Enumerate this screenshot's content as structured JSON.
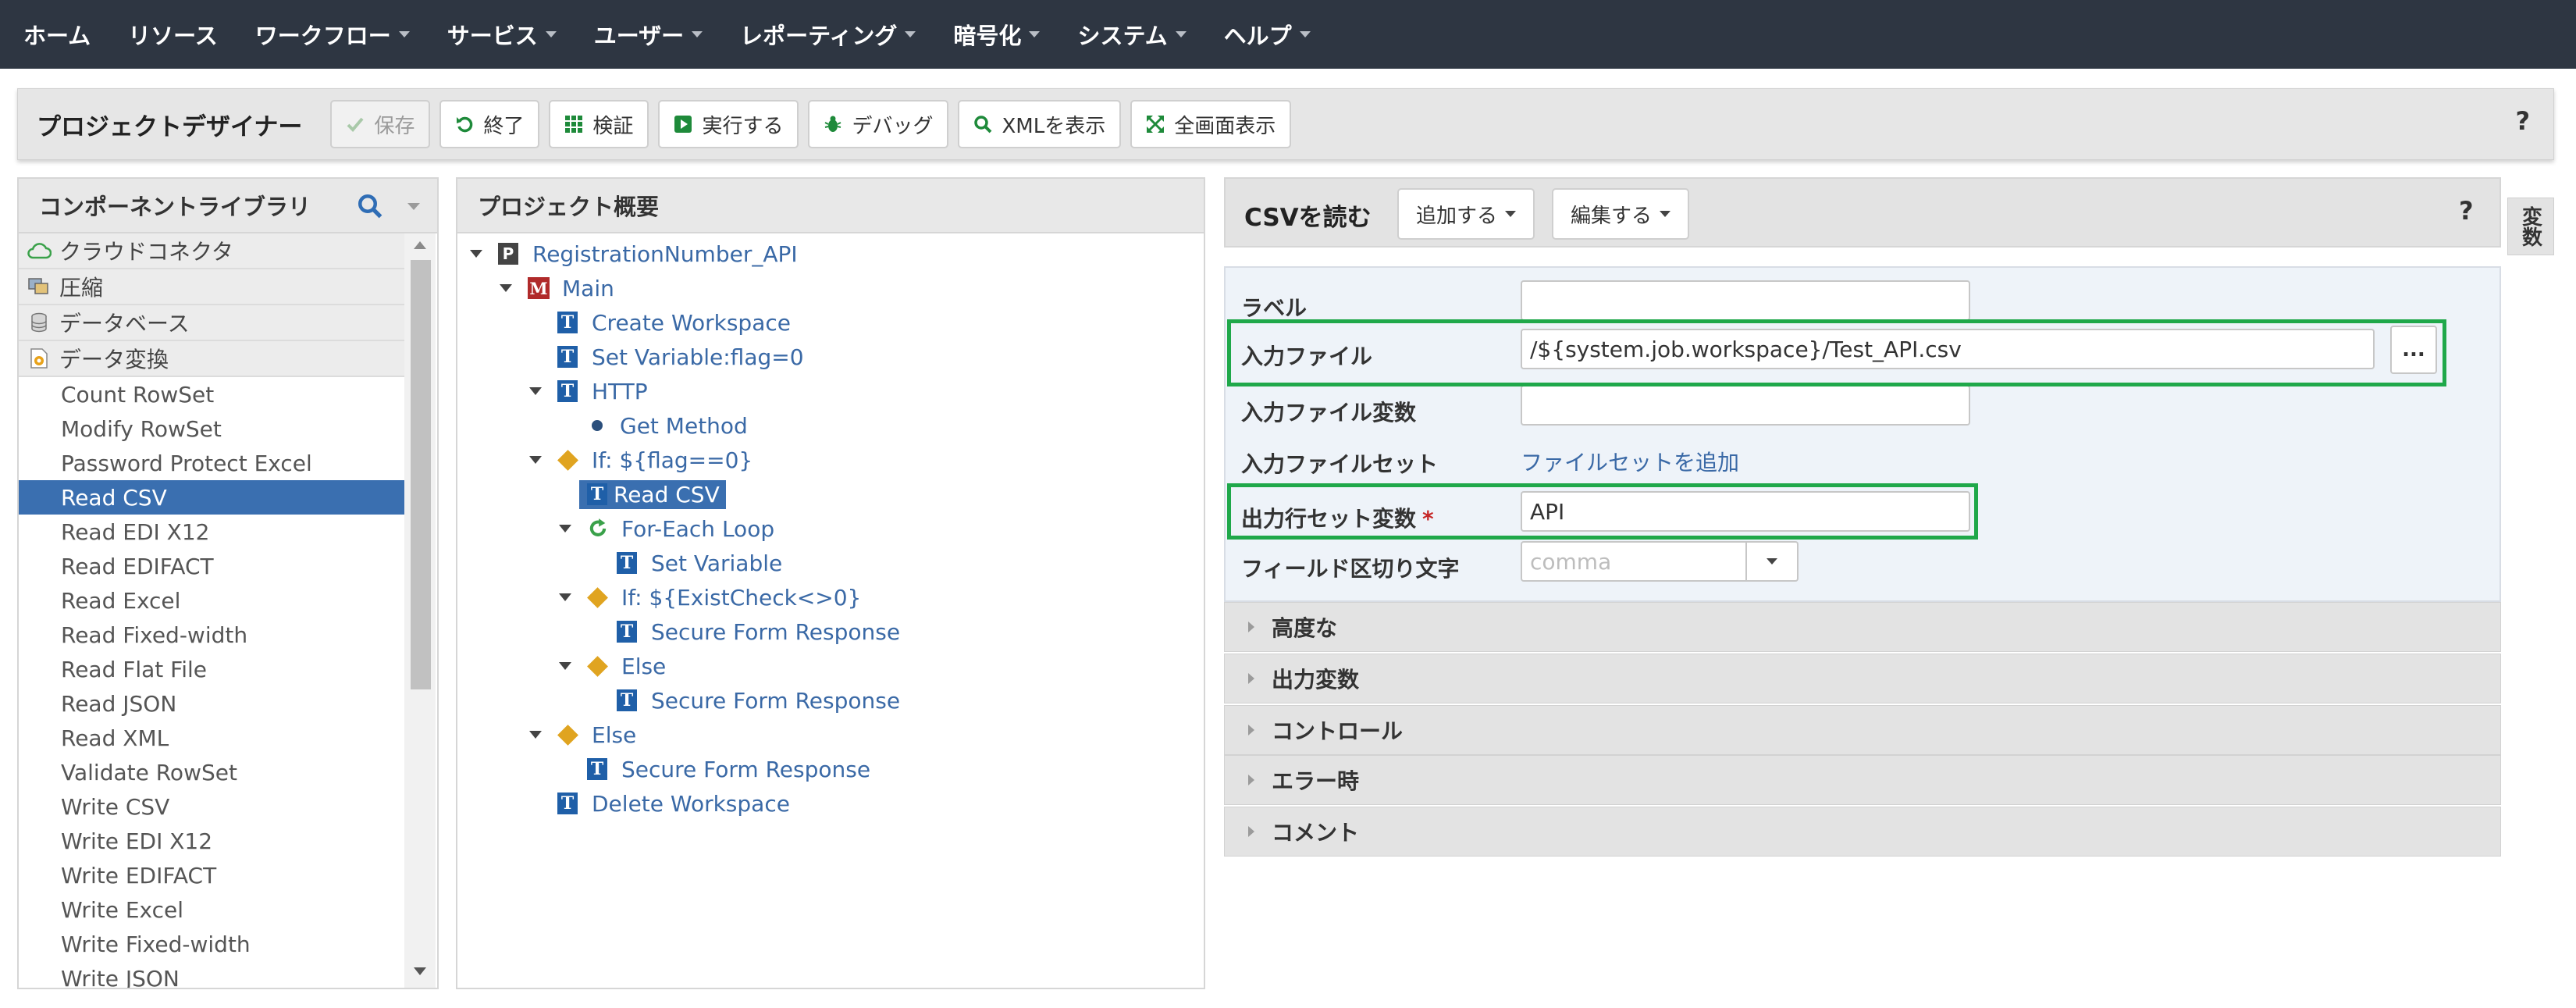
{
  "nav": {
    "items": [
      {
        "label": "ホーム",
        "has_caret": false
      },
      {
        "label": "リソース",
        "has_caret": false
      },
      {
        "label": "ワークフロー",
        "has_caret": true
      },
      {
        "label": "サービス",
        "has_caret": true
      },
      {
        "label": "ユーザー",
        "has_caret": true
      },
      {
        "label": "レポーティング",
        "has_caret": true
      },
      {
        "label": "暗号化",
        "has_caret": true
      },
      {
        "label": "システム",
        "has_caret": true
      },
      {
        "label": "ヘルプ",
        "has_caret": true
      }
    ]
  },
  "toolbar": {
    "title": "プロジェクトデザイナー",
    "buttons": [
      {
        "label": "保存",
        "icon": "check-icon",
        "disabled": true
      },
      {
        "label": "終了",
        "icon": "undo-icon",
        "disabled": false
      },
      {
        "label": "検証",
        "icon": "grid-icon",
        "disabled": false
      },
      {
        "label": "実行する",
        "icon": "play-icon",
        "disabled": false
      },
      {
        "label": "デバッグ",
        "icon": "bug-icon",
        "disabled": false
      },
      {
        "label": "XMLを表示",
        "icon": "search-icon",
        "disabled": false
      },
      {
        "label": "全画面表示",
        "icon": "expand-icon",
        "disabled": false
      }
    ],
    "help": "?"
  },
  "library": {
    "title": "コンポーネントライブラリ",
    "categories": [
      {
        "label": "クラウドコネクタ",
        "icon": "cloud-icon"
      },
      {
        "label": "圧縮",
        "icon": "compress-icon"
      },
      {
        "label": "データベース",
        "icon": "database-icon"
      },
      {
        "label": "データ変換",
        "icon": "transform-icon"
      }
    ],
    "items": [
      "Count RowSet",
      "Modify RowSet",
      "Password Protect Excel",
      "Read CSV",
      "Read EDI X12",
      "Read EDIFACT",
      "Read Excel",
      "Read Fixed-width",
      "Read Flat File",
      "Read JSON",
      "Read XML",
      "Validate RowSet",
      "Write CSV",
      "Write EDI X12",
      "Write EDIFACT",
      "Write Excel",
      "Write Fixed-width",
      "Write JSON"
    ],
    "selected_item": "Read CSV"
  },
  "overview": {
    "title": "プロジェクト概要",
    "nodes": [
      {
        "label": "RegistrationNumber_API",
        "icon": "project-icon",
        "depth": 0,
        "expanded": true
      },
      {
        "label": "Main",
        "icon": "module-icon",
        "depth": 1,
        "expanded": true
      },
      {
        "label": "Create Workspace",
        "icon": "task-icon",
        "depth": 2
      },
      {
        "label": "Set Variable:flag=0",
        "icon": "task-icon",
        "depth": 2
      },
      {
        "label": "HTTP",
        "icon": "task-icon",
        "depth": 2,
        "expanded": true
      },
      {
        "label": "Get Method",
        "icon": "bullet-icon",
        "depth": 3
      },
      {
        "label": "If: ${flag==0}",
        "icon": "condition-icon",
        "depth": 2,
        "expanded": true
      },
      {
        "label": "Read CSV",
        "icon": "task-icon",
        "depth": 3,
        "selected": true
      },
      {
        "label": "For-Each Loop",
        "icon": "loop-icon",
        "depth": 3,
        "expanded": true
      },
      {
        "label": "Set Variable",
        "icon": "task-icon",
        "depth": 4
      },
      {
        "label": "If: ${ExistCheck<>0}",
        "icon": "condition-icon",
        "depth": 3,
        "expanded": true
      },
      {
        "label": "Secure Form Response",
        "icon": "task-icon",
        "depth": 4
      },
      {
        "label": "Else",
        "icon": "condition-icon",
        "depth": 3,
        "expanded": true
      },
      {
        "label": "Secure Form Response",
        "icon": "task-icon",
        "depth": 4
      },
      {
        "label": "Else",
        "icon": "condition-icon",
        "depth": 2,
        "expanded": true
      },
      {
        "label": "Secure Form Response",
        "icon": "task-icon",
        "depth": 3
      },
      {
        "label": "Delete Workspace",
        "icon": "task-icon",
        "depth": 2
      }
    ]
  },
  "props": {
    "title": "CSVを読む",
    "add_button": "追加する",
    "edit_button": "編集する",
    "help": "?",
    "side_tab": "変数",
    "fields": {
      "label": {
        "label": "ラベル",
        "value": ""
      },
      "input_file": {
        "label": "入力ファイル",
        "value": "/${system.job.workspace}/Test_API.csv",
        "browse": "..."
      },
      "input_file_var": {
        "label": "入力ファイル変数",
        "value": ""
      },
      "input_fileset": {
        "label": "入力ファイルセット",
        "link": "ファイルセットを追加"
      },
      "output_rowset_var": {
        "label": "出力行セット変数",
        "required_mark": "*",
        "value": "API"
      },
      "field_delimiter": {
        "label": "フィールド区切り文字",
        "placeholder": "comma"
      }
    },
    "sections": [
      "高度な",
      "出力変数",
      "コントロール",
      "エラー時",
      "コメント"
    ]
  },
  "colors": {
    "navbar": "#2e3642",
    "selection": "#3a6fb0",
    "link": "#3a69a6",
    "highlight_box": "#1fa84a",
    "required": "#c62828"
  }
}
